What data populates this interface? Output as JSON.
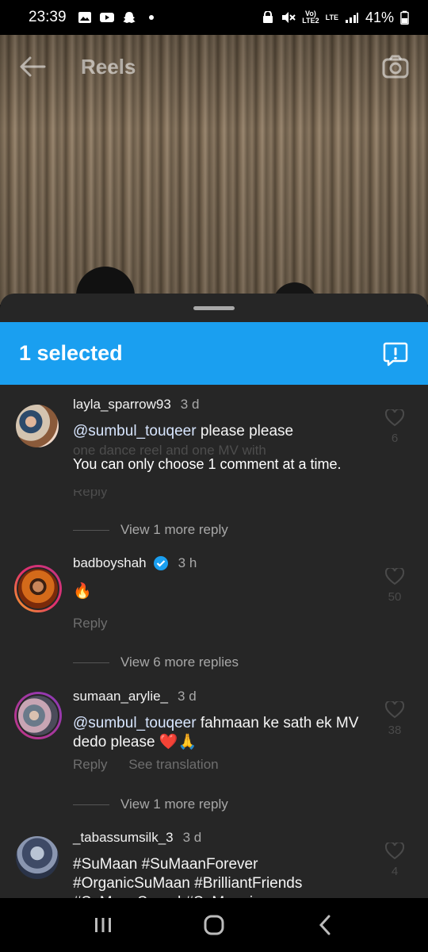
{
  "status_bar": {
    "time": "23:39",
    "network_top": "Vo)",
    "network_bottom": "LTE2",
    "lte_top": "LTE",
    "battery": "41%"
  },
  "header": {
    "title": "Reels"
  },
  "selection_bar": {
    "title": "1 selected",
    "color": "#1a9ff0"
  },
  "toast": "You can only choose 1 comment at a time.",
  "comments": [
    {
      "username": "layla_sparrow93",
      "time": "3 d",
      "mention": "@sumbul_touqeer",
      "text": " please please",
      "hidden_text": "one dance reel and one MV with",
      "likes": "6",
      "reply": "Reply",
      "view_more": "View 1 more reply"
    },
    {
      "username": "badboyshah",
      "time": "3 h",
      "text": "🔥",
      "likes": "50",
      "reply": "Reply",
      "view_more": "View 6 more replies"
    },
    {
      "username": "sumaan_arylie_",
      "time": "3 d",
      "mention": "@sumbul_touqeer",
      "text": " fahmaan ke sath ek MV dedo please ❤️🙏",
      "likes": "38",
      "reply": "Reply",
      "translate": "See translation",
      "view_more": "View 1 more reply"
    },
    {
      "username": "_tabassumsilk_3",
      "time": "3 d",
      "text": "#SuMaan #SuMaanForever #OrganicSuMaan #BrilliantFriends #SuMaanSquad #SuMaanian",
      "likes": "4"
    }
  ]
}
